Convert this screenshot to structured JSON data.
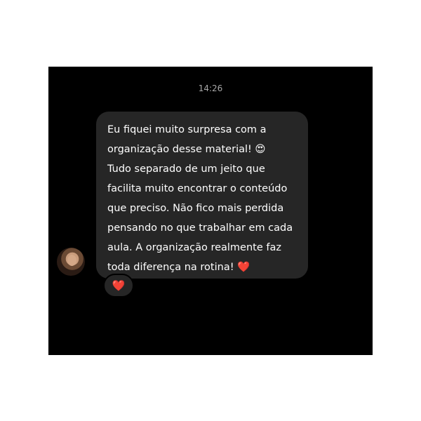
{
  "conversation": {
    "timestamp": "14:26",
    "message": {
      "lines": [
        "Eu fiquei muito surpresa com a",
        "organização desse material! 😍",
        "Tudo separado de um jeito que",
        "facilita muito encontrar o conteúdo",
        "que preciso. Não fico mais perdida",
        "pensando no que trabalhar em cada",
        "aula. A organização realmente faz",
        "toda diferença na rotina! ❤️"
      ],
      "reaction": "❤️"
    },
    "avatar_icon": "user-avatar-photo"
  },
  "colors": {
    "background": "#000000",
    "bubble": "#262626",
    "timestamp": "#a8a8a8",
    "text": "#ffffff"
  }
}
